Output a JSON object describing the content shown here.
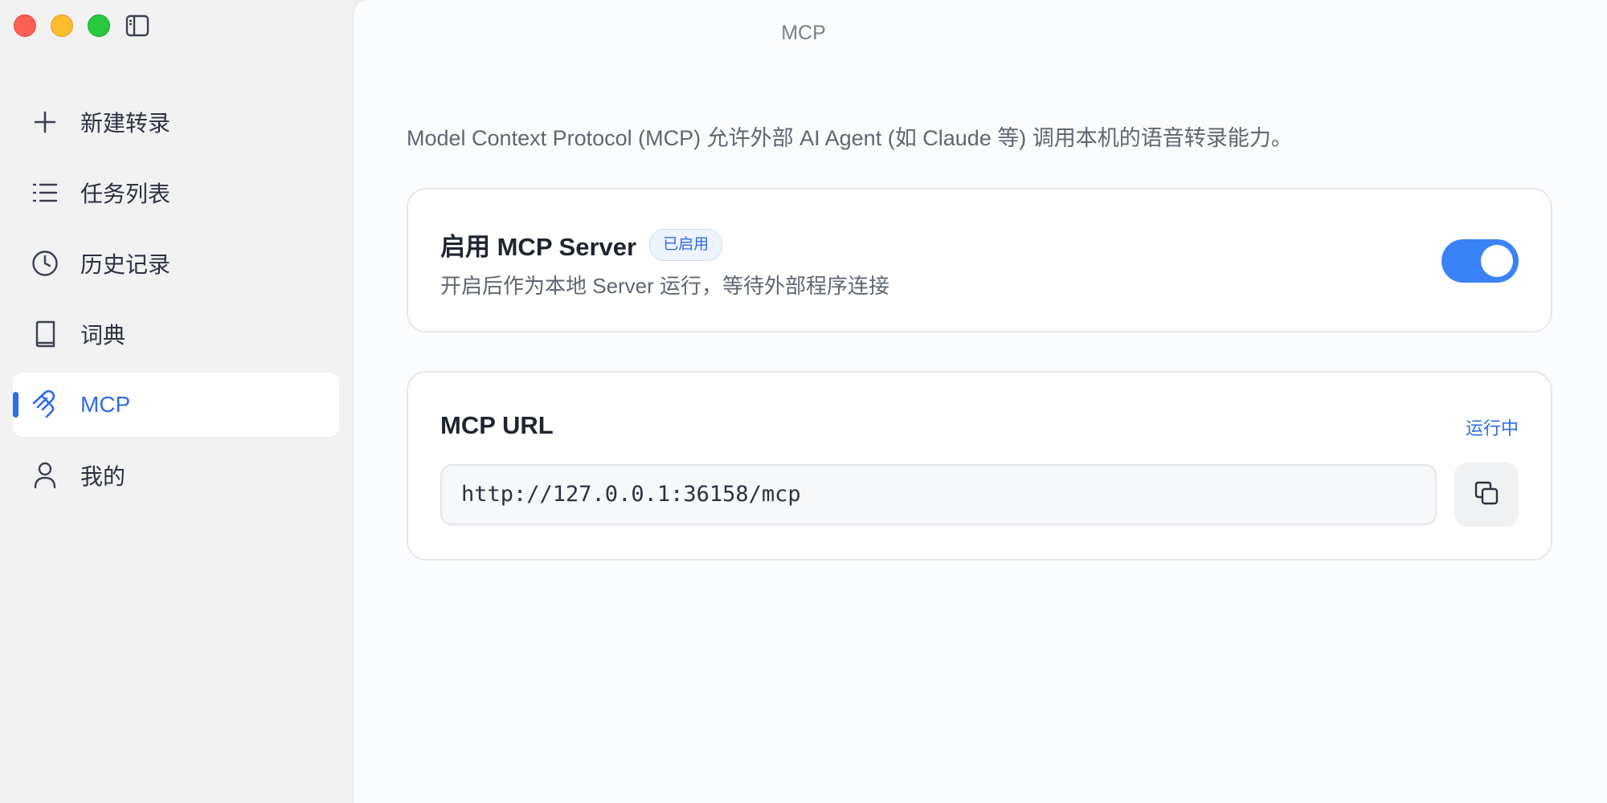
{
  "window": {
    "title": "MCP",
    "controls": [
      "close",
      "minimize",
      "maximize"
    ],
    "sidebar_toggle_icon": "sidebar-toggle-icon"
  },
  "sidebar": {
    "items": [
      {
        "label": "新建转录",
        "icon": "plus-icon",
        "active": false
      },
      {
        "label": "任务列表",
        "icon": "list-icon",
        "active": false
      },
      {
        "label": "历史记录",
        "icon": "clock-icon",
        "active": false
      },
      {
        "label": "词典",
        "icon": "book-icon",
        "active": false
      },
      {
        "label": "MCP",
        "icon": "mcp-icon",
        "active": true
      },
      {
        "label": "我的",
        "icon": "user-icon",
        "active": false
      }
    ]
  },
  "main": {
    "description": "Model Context Protocol (MCP) 允许外部 AI Agent (如 Claude 等) 调用本机的语音转录能力。",
    "server_card": {
      "title": "启用 MCP Server",
      "badge": "已启用",
      "subtitle": "开启后作为本地 Server 运行，等待外部程序连接",
      "enabled": true
    },
    "url_card": {
      "title": "MCP URL",
      "status": "运行中",
      "url": "http://127.0.0.1:36158/mcp",
      "copy_icon": "copy-icon"
    }
  },
  "colors": {
    "accent": "#2f6bed",
    "toggle_on": "#3b82f6",
    "close": "#fe5f57",
    "minimize": "#febc2e",
    "maximize": "#28c840"
  }
}
